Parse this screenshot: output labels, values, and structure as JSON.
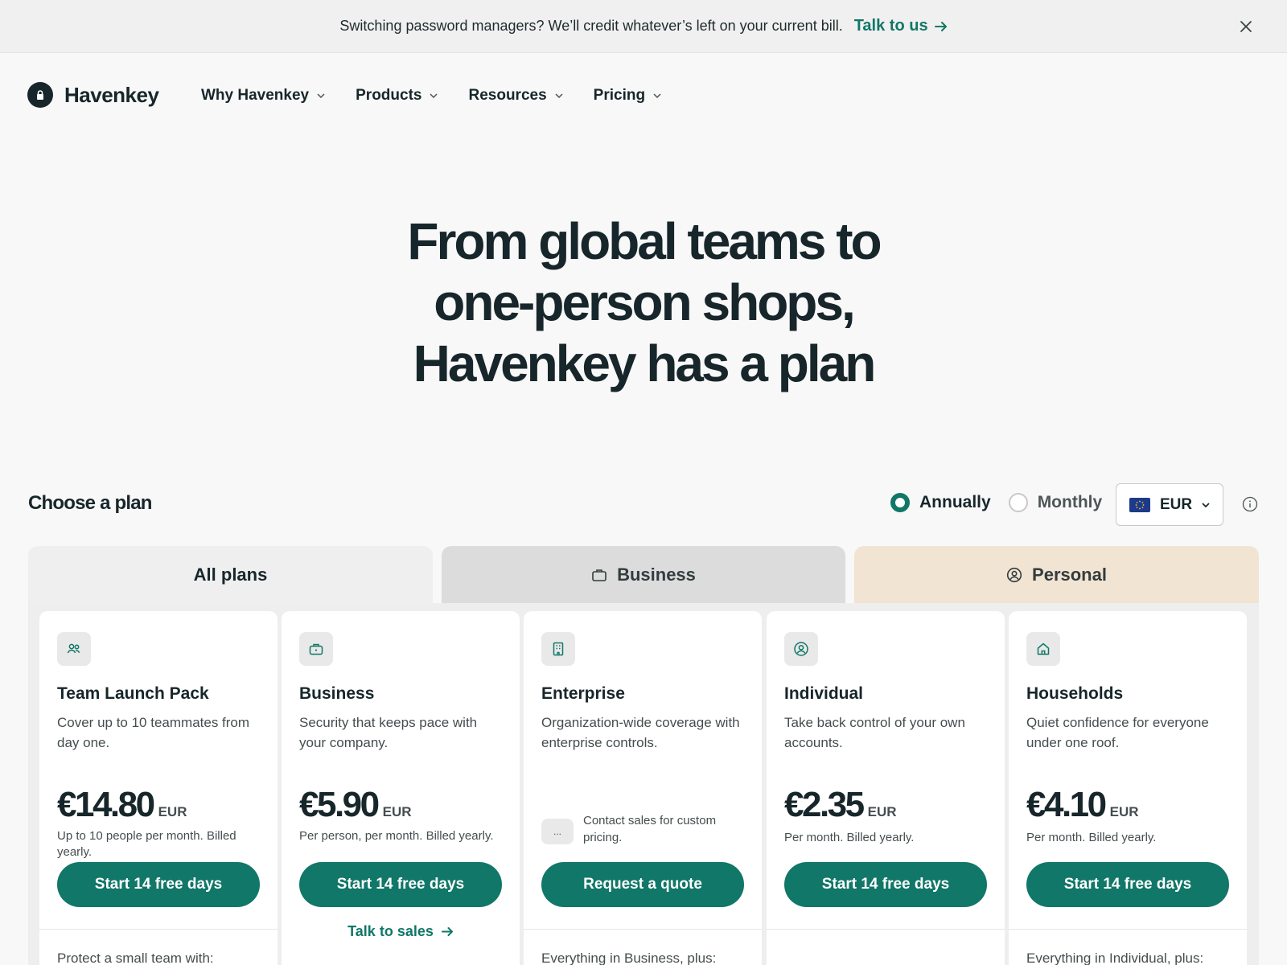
{
  "banner": {
    "message": "Switching password managers? We’ll credit whatever’s left on your current bill.",
    "link_label": "Talk to us",
    "close_icon": "close-icon"
  },
  "brand": {
    "name": "Havenkey",
    "logo_icon": "lock-icon"
  },
  "nav": {
    "items": [
      {
        "label": "Why Havenkey"
      },
      {
        "label": "Products"
      },
      {
        "label": "Resources"
      },
      {
        "label": "Pricing"
      }
    ]
  },
  "hero": {
    "lines": [
      "From global teams to",
      "one-person shops,",
      "Havenkey has a plan"
    ]
  },
  "plan_chooser": {
    "title": "Choose a plan",
    "billing_options": [
      {
        "label": "Annually",
        "selected": true
      },
      {
        "label": "Monthly",
        "selected": false
      }
    ],
    "currency": "EUR",
    "currency_flag": "eu-flag-icon",
    "info_icon": "info-icon"
  },
  "tabs": [
    {
      "label": "All plans",
      "icon": ""
    },
    {
      "label": "Business",
      "icon": "briefcase-icon"
    },
    {
      "label": "Personal",
      "icon": "user-circle-icon"
    }
  ],
  "plans": [
    {
      "icon": "users-icon",
      "name": "Team Launch Pack",
      "description": "Cover up to 10 teammates from day one.",
      "price": "€14.80",
      "currency": "EUR",
      "price_note": "Up to 10 people per month. Billed yearly.",
      "cta": "Start 14 free days",
      "footer": "Protect a small team with:"
    },
    {
      "icon": "briefcase-icon",
      "name": "Business",
      "description": "Security that keeps pace with your company.",
      "price": "€5.90",
      "currency": "EUR",
      "price_note": "Per person, per month. Billed yearly.",
      "cta": "Start 14 free days",
      "secondary_link": "Talk to sales"
    },
    {
      "icon": "building-icon",
      "name": "Enterprise",
      "description": "Organization-wide coverage with enterprise controls.",
      "contact_icon_text": "...",
      "contact_note": "Contact sales for custom pricing.",
      "cta": "Request a quote",
      "footer": "Everything in Business, plus:"
    },
    {
      "icon": "user-circle-icon",
      "name": "Individual",
      "description": "Take back control of your own accounts.",
      "price": "€2.35",
      "currency": "EUR",
      "price_note": "Per month. Billed yearly.",
      "cta": "Start 14 free days"
    },
    {
      "icon": "home-icon",
      "name": "Households",
      "description": "Quiet confidence for everyone under one roof.",
      "price": "€4.10",
      "currency": "EUR",
      "price_note": "Per month. Billed yearly.",
      "cta": "Start 14 free days",
      "footer": "Everything in Individual, plus:"
    }
  ],
  "colors": {
    "accent": "#117768",
    "ink": "#17262a",
    "personal_tab": "#f1e4d2",
    "business_tab": "#dcdcdc"
  }
}
